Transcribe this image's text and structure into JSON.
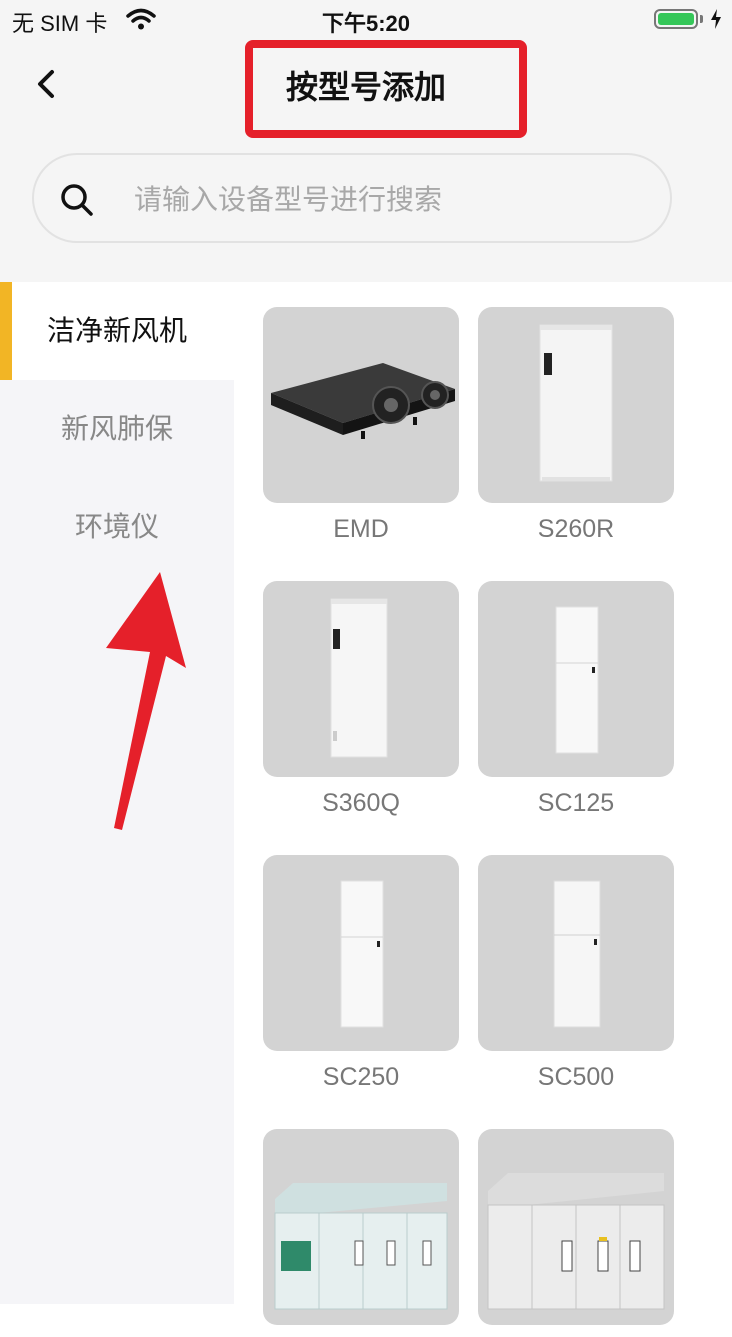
{
  "status_bar": {
    "carrier": "无 SIM 卡",
    "time": "下午5:20"
  },
  "header": {
    "title": "按型号添加"
  },
  "search": {
    "placeholder": "请输入设备型号进行搜索"
  },
  "sidebar": {
    "items": [
      {
        "label": "洁净新风机"
      },
      {
        "label": "新风肺保"
      },
      {
        "label": "环境仪"
      }
    ]
  },
  "products": [
    {
      "label": "EMD"
    },
    {
      "label": "S260R"
    },
    {
      "label": "S360Q"
    },
    {
      "label": "SC125"
    },
    {
      "label": "SC250"
    },
    {
      "label": "SC500"
    },
    {
      "label": ""
    },
    {
      "label": ""
    }
  ],
  "colors": {
    "accent": "#f2b525",
    "highlight_box": "#e5202a",
    "annotation_arrow": "#e5202a"
  }
}
